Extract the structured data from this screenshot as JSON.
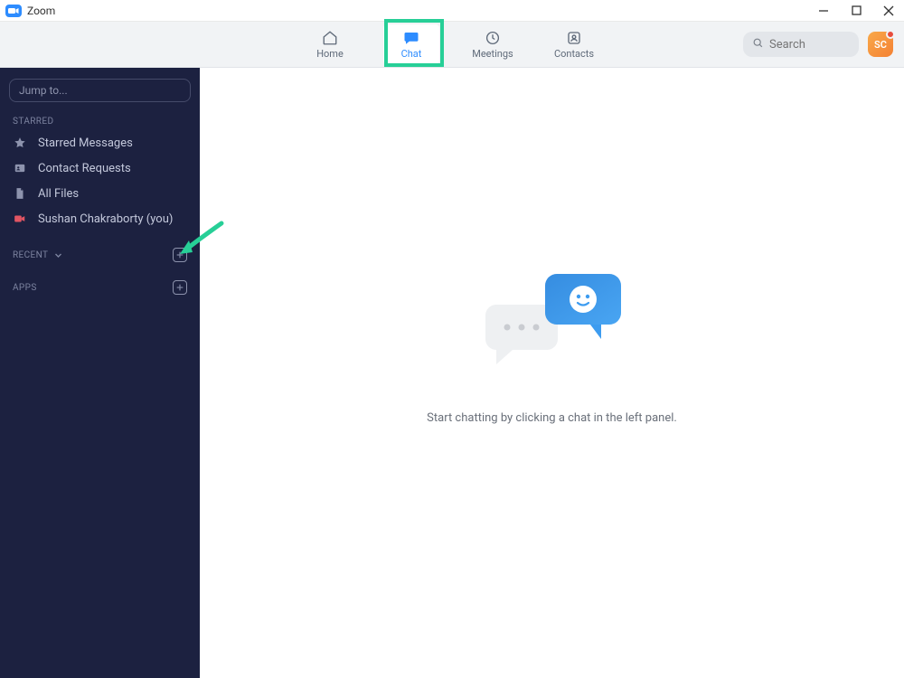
{
  "window": {
    "title": "Zoom"
  },
  "nav": {
    "tabs": [
      {
        "label": "Home"
      },
      {
        "label": "Chat"
      },
      {
        "label": "Meetings"
      },
      {
        "label": "Contacts"
      }
    ],
    "active_index": 1
  },
  "search": {
    "placeholder": "Search"
  },
  "avatar": {
    "initials": "SC"
  },
  "sidebar": {
    "jump_placeholder": "Jump to...",
    "groups": {
      "starred": {
        "label": "STARRED",
        "items": [
          {
            "label": "Starred Messages"
          },
          {
            "label": "Contact Requests"
          },
          {
            "label": "All Files"
          },
          {
            "label": "Sushan Chakraborty (you)"
          }
        ]
      },
      "recent": {
        "label": "RECENT"
      },
      "apps": {
        "label": "APPS"
      }
    }
  },
  "main": {
    "empty_text": "Start chatting by clicking a chat in the left panel."
  },
  "annotation": {
    "chat_tab_highlight": true,
    "arrow_to_recent_plus": true,
    "accent_color": "#27cf97"
  }
}
